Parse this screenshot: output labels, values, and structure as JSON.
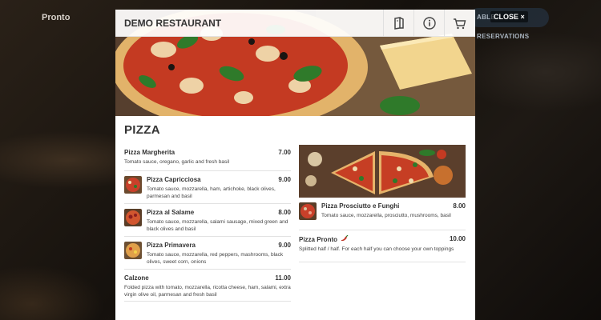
{
  "background": {
    "brand": "Pronto",
    "pill_text": "ABLE RESERVATIONS"
  },
  "close_label": "CLOSE ×",
  "restaurant": {
    "name": "DEMO RESTAURANT",
    "header_icons": [
      "menu-book-icon",
      "info-icon",
      "cart-icon"
    ]
  },
  "section": {
    "title": "PIZZA"
  },
  "left_items": [
    {
      "name": "Pizza Margherita",
      "price": "7.00",
      "desc": "Tomato sauce, oregano, garlic and fresh basil",
      "thumb": false
    },
    {
      "name": "Pizza Capricciosa",
      "price": "9.00",
      "desc": "Tomato sauce, mozzarella, ham, artichoke, black olives, parmesan and basil",
      "thumb": true
    },
    {
      "name": "Pizza al Salame",
      "price": "8.00",
      "desc": "Tomato sauce, mozzarella, salami sausage, mixed green and black olives and basil",
      "thumb": true
    },
    {
      "name": "Pizza Primavera",
      "price": "9.00",
      "desc": "Tomato sauce, mozzarella, red peppers, mashrooms, black olives, sweet corn, onions",
      "thumb": true
    },
    {
      "name": "Calzone",
      "price": "11.00",
      "desc": "Folded pizza with tomato, mozzarella, ricotta cheese, ham, salami, extra virgin olive oil, parmesan and fresh basil",
      "thumb": false
    }
  ],
  "right_items": [
    {
      "name": "Pizza Prosciutto e Funghi",
      "price": "8.00",
      "desc": "Tomato sauce, mozzarella, prosciutto, mushrooms, basil",
      "thumb": true
    },
    {
      "name": "Pizza Pronto",
      "price": "10.00",
      "desc": "Splitted half / half. For each half you can choose your own toppings",
      "thumb": false,
      "spicy": true
    }
  ],
  "colors": {
    "text": "#333333",
    "divider": "#e2e2e2",
    "modal_bg": "#ffffff",
    "chili": "#c0392b"
  }
}
